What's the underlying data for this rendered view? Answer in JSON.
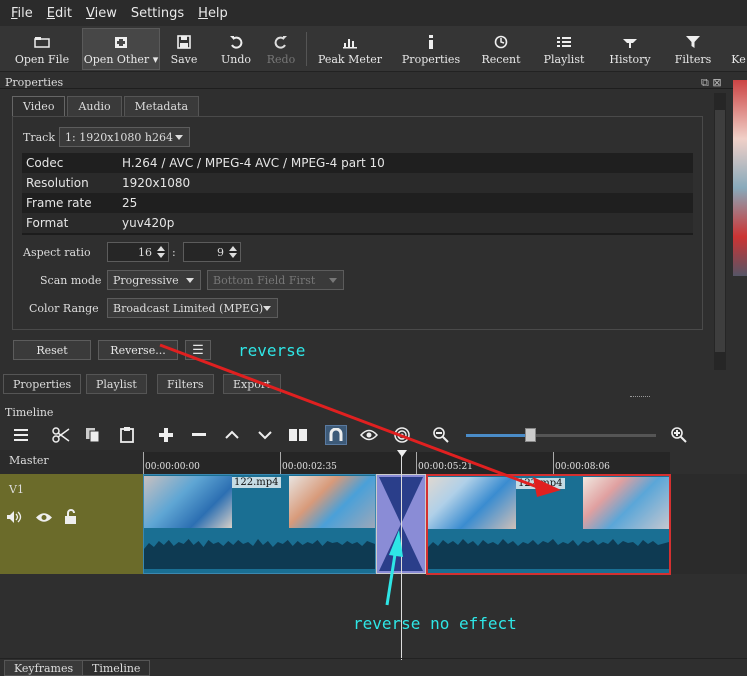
{
  "menu": [
    {
      "label": "File",
      "accel": "F",
      "rest": "ile"
    },
    {
      "label": "Edit",
      "accel": "E",
      "rest": "dit"
    },
    {
      "label": "View",
      "accel": "V",
      "rest": "iew"
    },
    {
      "label": "Settings",
      "accel": "",
      "rest": "Settings"
    },
    {
      "label": "Help",
      "accel": "H",
      "rest": "elp"
    }
  ],
  "toolbar": {
    "open_file": "Open File",
    "open_other": "Open Other",
    "save": "Save",
    "undo": "Undo",
    "redo": "Redo",
    "peak_meter": "Peak Meter",
    "properties": "Properties",
    "recent": "Recent",
    "playlist": "Playlist",
    "history": "History",
    "filters": "Filters",
    "keyframes_truncated": "Ke"
  },
  "properties": {
    "title": "Properties",
    "tabs": [
      "Video",
      "Audio",
      "Metadata"
    ],
    "track_label": "Track",
    "track_value": "1: 1920x1080 h264",
    "info": [
      {
        "key": "Codec",
        "value": "H.264 / AVC / MPEG-4 AVC / MPEG-4 part 10"
      },
      {
        "key": "Resolution",
        "value": "1920x1080"
      },
      {
        "key": "Frame rate",
        "value": "25"
      },
      {
        "key": "Format",
        "value": "yuv420p"
      }
    ],
    "aspect_label": "Aspect ratio",
    "aspect_w": "16",
    "aspect_sep": ":",
    "aspect_h": "9",
    "scan_label": "Scan mode",
    "scan_value": "Progressive",
    "field_value": "Bottom Field First",
    "range_label": "Color Range",
    "range_value": "Broadcast Limited (MPEG)",
    "reset_button": "Reset",
    "reverse_button": "Reverse...",
    "menu_button": "☰"
  },
  "dock_tabs": [
    "Properties",
    "Playlist",
    "Filters",
    "Export"
  ],
  "timeline": {
    "title": "Timeline",
    "master_label": "Master",
    "track_name": "V1",
    "timecodes": [
      "00:00:00:00",
      "00:00:02:35",
      "00:00:05:21",
      "00:00:08:06"
    ],
    "clip1_label": "122.mp4",
    "clip2_label": "122.mp4"
  },
  "bottom_tabs": [
    "Keyframes",
    "Timeline"
  ],
  "annotations": {
    "reverse": "reverse",
    "no_effect": "reverse no effect"
  },
  "colors": {
    "accent_cyan": "#2ee6e6",
    "arrow_red": "#e02020",
    "clip_blue": "#1a6f93",
    "track_head": "#6b6b2a",
    "transition": "#8a8cd6"
  }
}
